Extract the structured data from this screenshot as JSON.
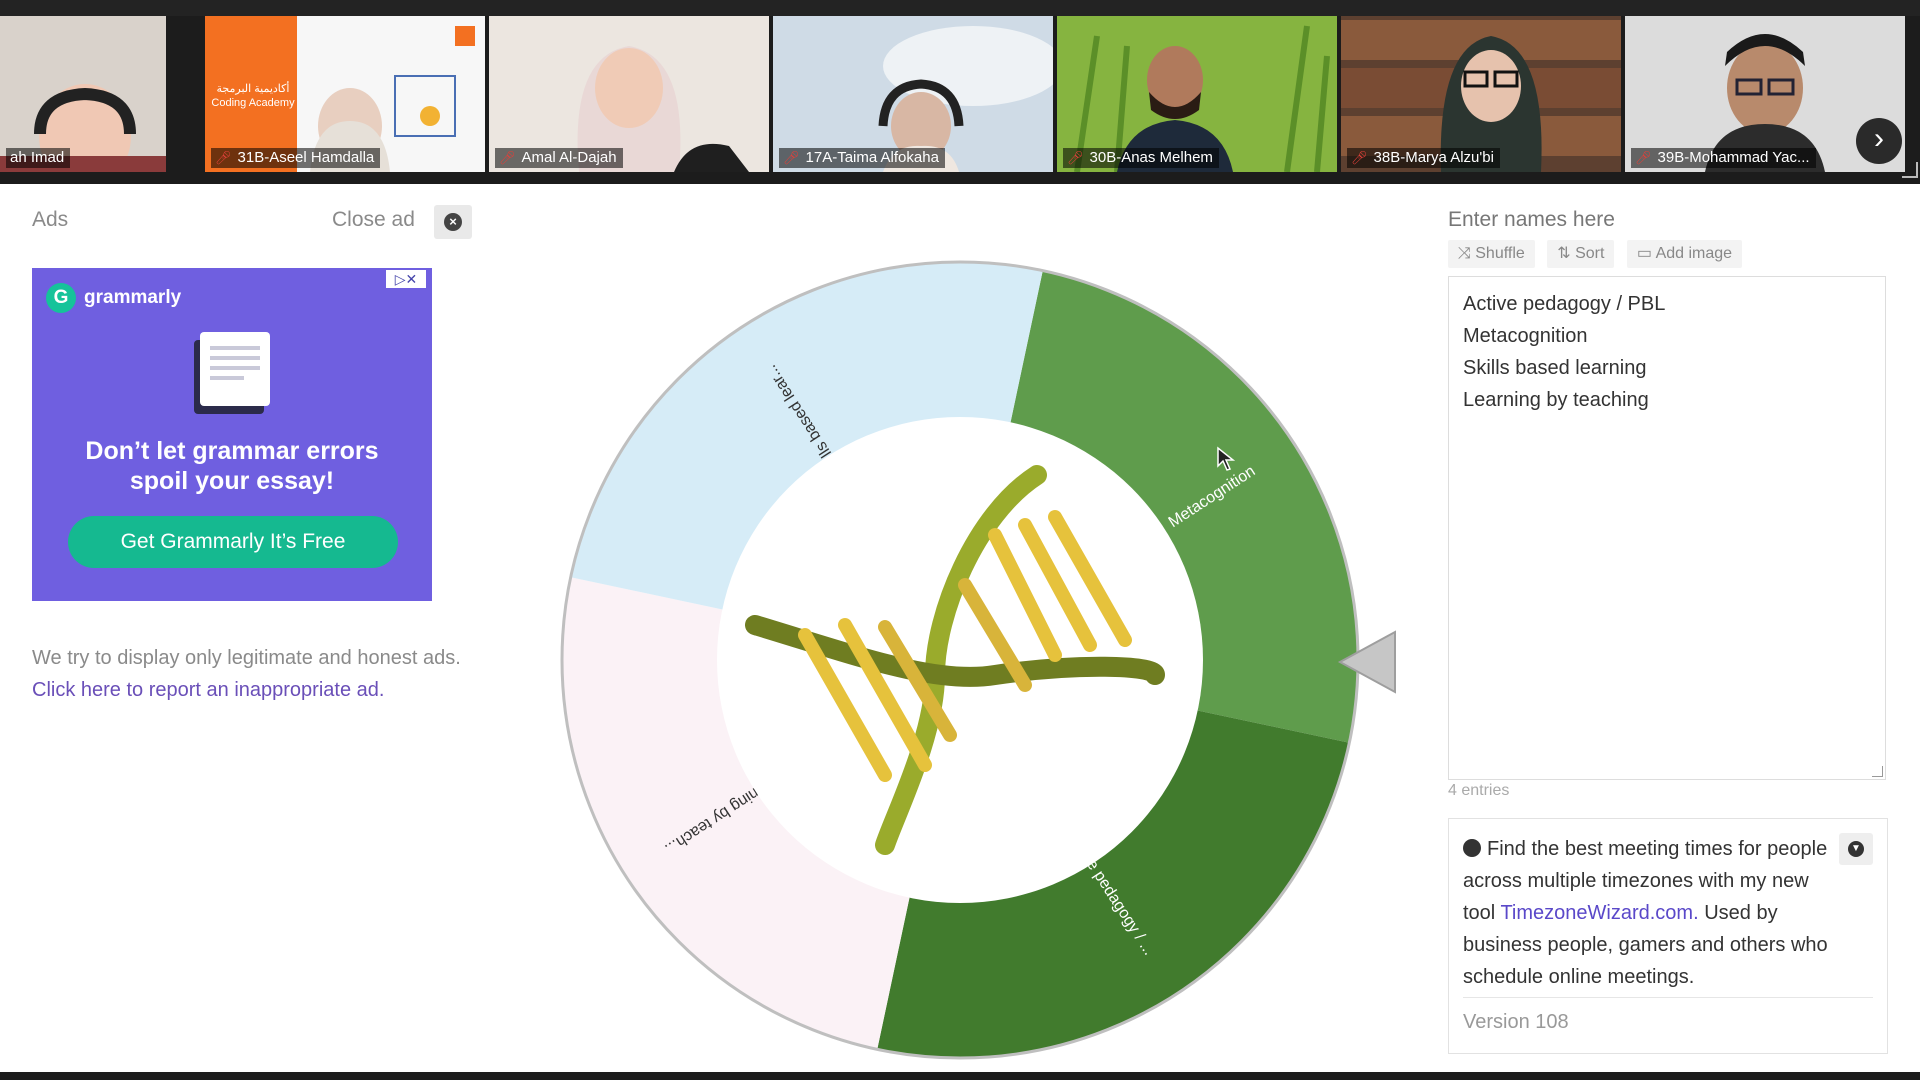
{
  "participants": [
    {
      "name": "ah Imad",
      "bg": "#6e5a4a"
    },
    {
      "name": "31B-Aseel Hamdalla",
      "bg": "#f6f6f6"
    },
    {
      "name": "Amal Al-Dajah",
      "bg": "#ece6e0"
    },
    {
      "name": "17A-Taima Alfokaha",
      "bg": "#cfdbe6"
    },
    {
      "name": "30B-Anas Melhem",
      "bg": "#7aa838"
    },
    {
      "name": "38B-Marya Alzu'bi",
      "bg": "#6b4a36"
    },
    {
      "name": "39B-Mohammad Yac...",
      "bg": "#d8d8d8"
    }
  ],
  "coding_academy": {
    "arabic": "أكاديمية البرمجة",
    "english": "Coding Academy"
  },
  "ads": {
    "label": "Ads",
    "close_label": "Close ad",
    "note_prefix": "We try to display only legitimate and honest ads. ",
    "note_link": "Click here to report an inappropriate ad."
  },
  "grammarly_ad": {
    "brand": "grammarly",
    "headline_1": "Don’t let grammar errors",
    "headline_2": "spoil your essay!",
    "cta": "Get Grammarly  It’s Free"
  },
  "wheel": {
    "segments": [
      {
        "label": "Metacognition",
        "color": "#5f9c4c"
      },
      {
        "label": "Active pedagogy / ...",
        "color": "#417b2d"
      },
      {
        "label": "Learning by teach...",
        "color": "#fbf2f6"
      },
      {
        "label": "Skills based lear...",
        "color": "#d6ecf7"
      }
    ],
    "pointer_color": "#c6c6c6"
  },
  "names_panel": {
    "title": "Enter names here",
    "shuffle": "Shuffle",
    "sort": "Sort",
    "add_image": "Add image",
    "entries": [
      "Active pedagogy / PBL",
      "Metacognition",
      "Skills based learning",
      "Learning by teaching"
    ],
    "count_label": "4 entries"
  },
  "timezone_box": {
    "text_1": "Find the best meeting times for people across multiple timezones with my new tool ",
    "link": "TimezoneWizard.com.",
    "text_2": " Used by business people, gamers and others who schedule online meetings.",
    "version": "Version 108"
  }
}
